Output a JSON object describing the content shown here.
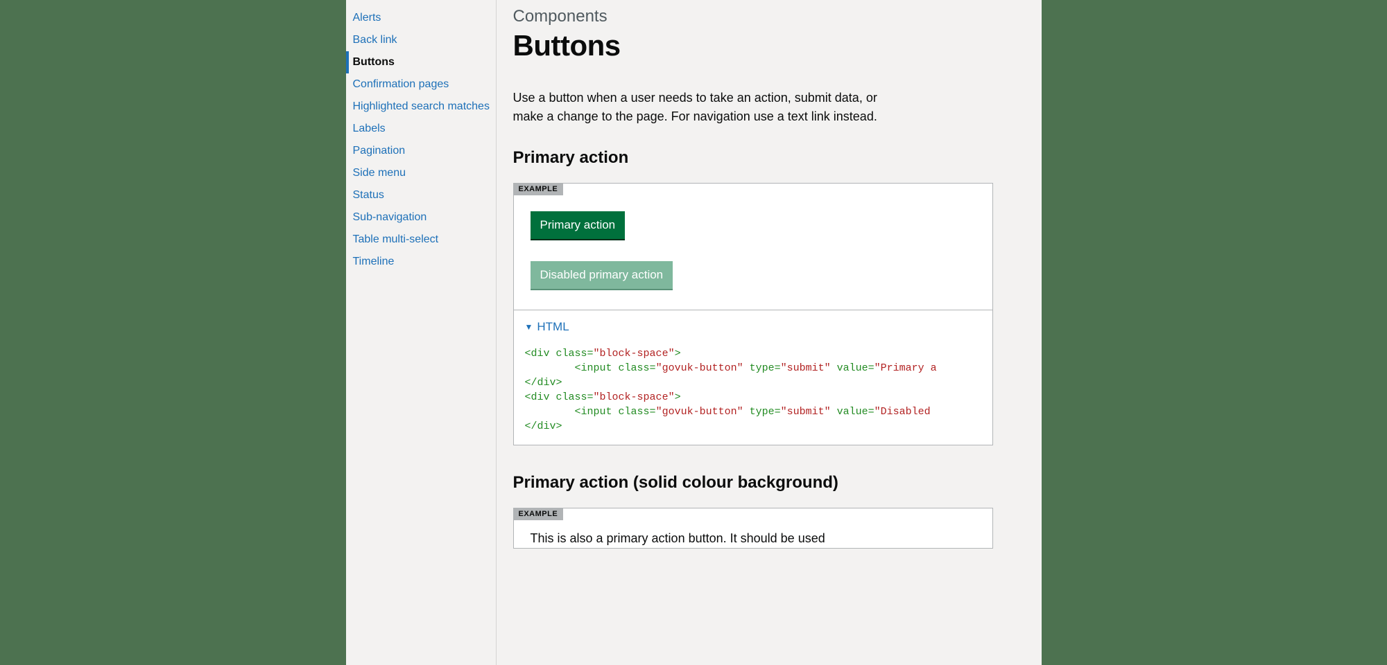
{
  "sidebar": {
    "items": [
      {
        "label": "Alerts"
      },
      {
        "label": "Back link"
      },
      {
        "label": "Buttons"
      },
      {
        "label": "Confirmation pages"
      },
      {
        "label": "Highlighted search matches"
      },
      {
        "label": "Labels"
      },
      {
        "label": "Pagination"
      },
      {
        "label": "Side menu"
      },
      {
        "label": "Status"
      },
      {
        "label": "Sub-navigation"
      },
      {
        "label": "Table multi-select"
      },
      {
        "label": "Timeline"
      }
    ]
  },
  "breadcrumb": "Components",
  "page_title": "Buttons",
  "intro": "Use a button when a user needs to take an action, submit data, or make a change to the page. For navigation use a text link instead.",
  "section1": {
    "heading": "Primary action",
    "example_label": "EXAMPLE",
    "button_primary": "Primary action",
    "button_disabled": "Disabled primary action",
    "details_label": "HTML",
    "code_line1_a": "<div",
    "code_line1_b": "class=",
    "code_line1_c": "\"block-space\"",
    "code_line1_d": ">",
    "code_line2_a": "<input",
    "code_line2_b": "class=",
    "code_line2_c": "\"govuk-button\"",
    "code_line2_d": "type=",
    "code_line2_e": "\"submit\"",
    "code_line2_f": "value=",
    "code_line2_g": "\"Primary a",
    "code_line3": "</div>",
    "code_line4_a": "<div",
    "code_line4_b": "class=",
    "code_line4_c": "\"block-space\"",
    "code_line4_d": ">",
    "code_line5_a": "<input",
    "code_line5_b": "class=",
    "code_line5_c": "\"govuk-button\"",
    "code_line5_d": "type=",
    "code_line5_e": "\"submit\"",
    "code_line5_f": "value=",
    "code_line5_g": "\"Disabled",
    "code_line6": "</div>"
  },
  "section2": {
    "heading": "Primary action (solid colour background)",
    "example_label": "EXAMPLE",
    "text": "This is also a primary action button. It should be used"
  }
}
